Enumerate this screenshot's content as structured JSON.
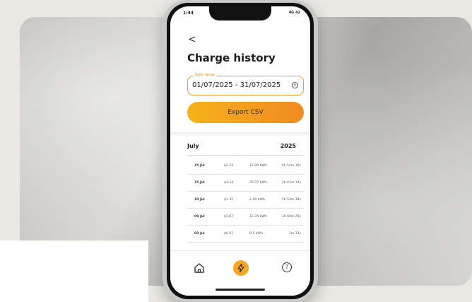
{
  "status": {
    "time": "1:44",
    "right": "4G 42"
  },
  "header": {
    "back_icon": "chevron-left-icon",
    "back": "<",
    "title": "Charge history"
  },
  "date_range": {
    "legend": "Date range",
    "value": "01/07/2025 - 31/07/2025",
    "clear_icon": "clear-circle-icon",
    "clear": "×"
  },
  "export": {
    "label": "Export CSV"
  },
  "list": {
    "month": "July",
    "year": "2025",
    "rows": [
      {
        "date": "15 Jul",
        "cost": "$2.24",
        "energy": "12.99 kWh",
        "time": "4h 54m 19s"
      },
      {
        "date": "15 Jul",
        "cost": "$3.24",
        "energy": "25.07 kWh",
        "time": "3h 41m 13s"
      },
      {
        "date": "10 Jul",
        "cost": "$1.35",
        "energy": "2.49 kWh",
        "time": "3h 53m 34s"
      },
      {
        "date": "09 Jul",
        "cost": "$1.67",
        "energy": "12.35 kWh",
        "time": "3h 46m 25s"
      },
      {
        "date": "02 Jul",
        "cost": "$0.02",
        "energy": "0.1 kWh",
        "time": "1m 33s"
      }
    ]
  },
  "nav": {
    "home_icon": "home-icon",
    "charge_icon": "lightning-icon",
    "help_icon": "help-icon",
    "help": "?"
  },
  "colors": {
    "accent": "#f6a623",
    "accent_end": "#f18a22",
    "border": "#f29a2e"
  }
}
